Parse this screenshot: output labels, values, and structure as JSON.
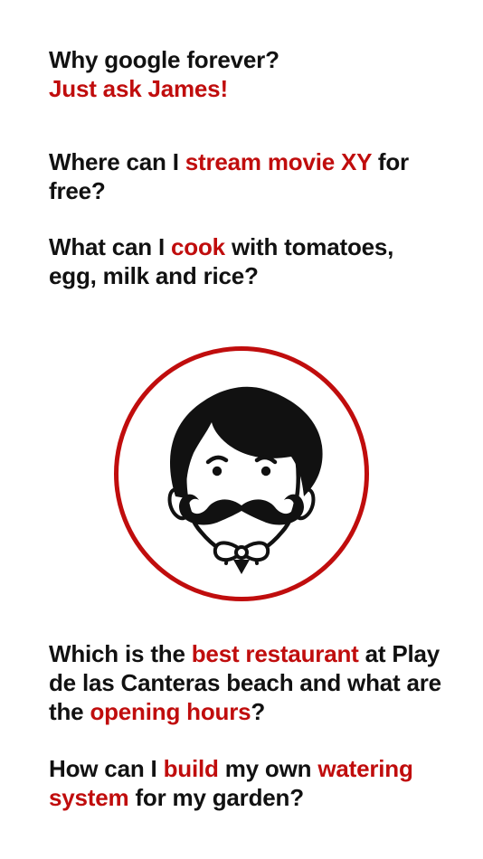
{
  "intro": {
    "line1": "Why google forever?",
    "line2": "Just ask James!"
  },
  "questions": [
    {
      "parts": [
        {
          "text": "Where can I ",
          "highlight": false
        },
        {
          "text": "stream movie XY",
          "highlight": true
        },
        {
          "text": " for free?",
          "highlight": false
        }
      ]
    },
    {
      "parts": [
        {
          "text": "What can I ",
          "highlight": false
        },
        {
          "text": "cook",
          "highlight": true
        },
        {
          "text": " with tomatoes, egg, milk and rice?",
          "highlight": false
        }
      ]
    },
    {
      "parts": [
        {
          "text": "Which is the ",
          "highlight": false
        },
        {
          "text": "best restaurant",
          "highlight": true
        },
        {
          "text": " at Play de las Canteras beach and what are the ",
          "highlight": false
        },
        {
          "text": "opening hours",
          "highlight": true
        },
        {
          "text": "?",
          "highlight": false
        }
      ]
    },
    {
      "parts": [
        {
          "text": "How can I ",
          "highlight": false
        },
        {
          "text": "build",
          "highlight": true
        },
        {
          "text": " my own ",
          "highlight": false
        },
        {
          "text": "watering system",
          "highlight": true
        },
        {
          "text": " for my garden?",
          "highlight": false
        }
      ]
    }
  ],
  "logo": {
    "icon": "butler-mustache-icon",
    "ring_color": "#c00d0d",
    "ink_color": "#111111"
  },
  "colors": {
    "accent": "#c00d0d",
    "text": "#111111",
    "background": "#ffffff"
  }
}
